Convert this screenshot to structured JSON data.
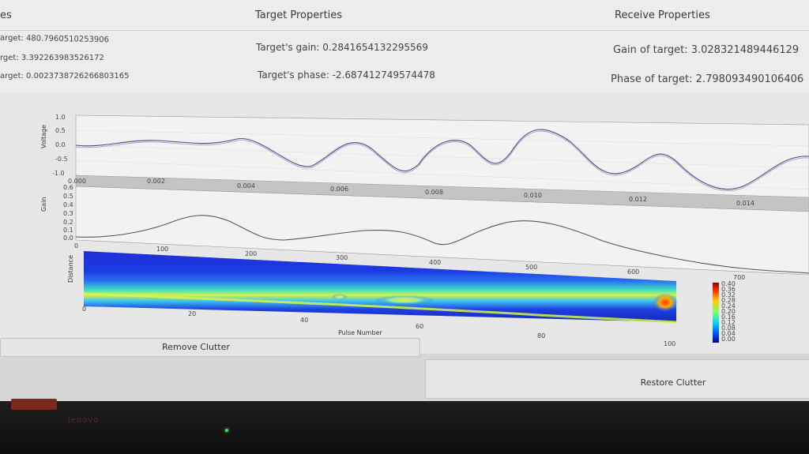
{
  "columns": {
    "left": {
      "title": "es",
      "rows": [
        {
          "label": "arget:",
          "value": "480.7960510253906"
        },
        {
          "label": "rget:",
          "value": "3.392263983526172"
        },
        {
          "label": "arget:",
          "value": "0.0023738726266803165"
        }
      ]
    },
    "middle": {
      "title": "Target Properties",
      "rows": [
        {
          "label": "Target's gain:",
          "value": "0.2841654132295569"
        },
        {
          "label": "Target's phase:",
          "value": "-2.687412749574478"
        }
      ]
    },
    "right": {
      "title": "Receive Properties",
      "rows": [
        {
          "label": "Gain of target:",
          "value": "3.028321489446129"
        },
        {
          "label": "Phase of target:",
          "value": "2.798093490106406"
        }
      ]
    }
  },
  "plots": {
    "top": {
      "ylabel": "Voltage",
      "yticks": [
        "1.0",
        "0.5",
        "0.0",
        "-0.5",
        "-1.0"
      ],
      "xticks": [
        "0.000",
        "0.002",
        "0.004",
        "0.006",
        "0.008",
        "0.010",
        "0.012",
        "0.014"
      ]
    },
    "middle": {
      "ylabel": "Gain",
      "yticks": [
        "0.6",
        "0.5",
        "0.4",
        "0.3",
        "0.2",
        "0.1",
        "0.0"
      ],
      "xticks": [
        "0",
        "100",
        "200",
        "300",
        "400",
        "500",
        "600",
        "700"
      ]
    },
    "heatmap": {
      "ylabel": "Distance",
      "xlabel": "Pulse Number",
      "xticks": [
        "0",
        "20",
        "40",
        "60",
        "80",
        "100"
      ],
      "colorbar_ticks": [
        "0.40",
        "0.36",
        "0.32",
        "0.28",
        "0.24",
        "0.20",
        "0.16",
        "0.12",
        "0.08",
        "0.04",
        "0.00"
      ]
    }
  },
  "buttons": {
    "remove_clutter": "Remove Clutter",
    "restore_clutter": "Restore Clutter"
  },
  "bezel": {
    "brand": "lenovo"
  }
}
